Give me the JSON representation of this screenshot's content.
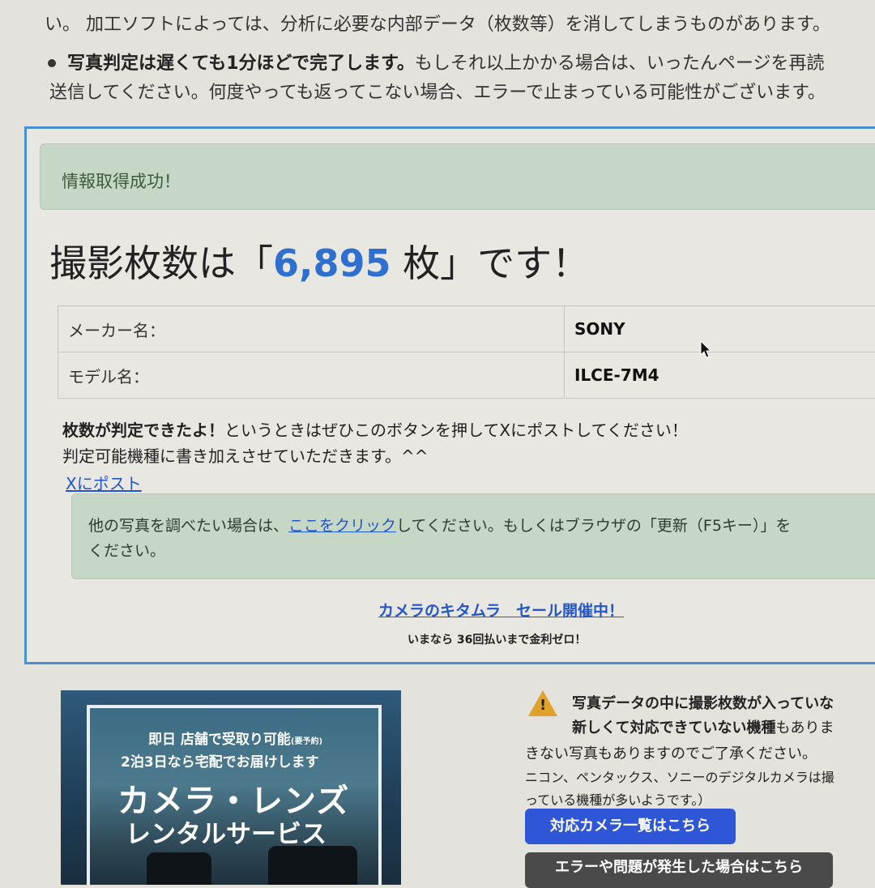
{
  "intro": {
    "line1": "い。 加工ソフトによっては、分析に必要な内部データ（枚数等）を消してしまうものがあります。",
    "bullet_bold": "写真判定は遅くても1分ほどで完了します。",
    "bullet_rest": "もしそれ以上かかる場合は、いったんページを再読",
    "bullet_line2": "送信してください。何度やっても返ってこない場合、エラーで止まっている可能性がございます。"
  },
  "result": {
    "success_message": "情報取得成功！",
    "headline_prefix": "撮影枚数は「",
    "shot_count": "6,895",
    "headline_suffix": " 枚」です！",
    "specs": [
      {
        "label": "メーカー名：",
        "value": "SONY"
      },
      {
        "label": "モデル名：",
        "value": "ILCE-7M4"
      }
    ],
    "note_bold": "枚数が判定できたよ！",
    "note_rest": "というときはぜひこのボタンを押してXにポストしてください！",
    "note_line2": "判定可能機種に書き加えさせていただきます。^^",
    "post_link": "Xにポスト",
    "other_prefix": "他の写真を調べたい場合は、",
    "other_link": "ここをクリック",
    "other_suffix": "してください。もしくはブラウザの「更新（F5キー）」を",
    "other_line2": "ください。",
    "sale_link": "カメラのキタムラ　セール開催中！",
    "sale_sub": "いまなら 36回払いまで金利ゼロ！"
  },
  "banner": {
    "line1": "即日 店舗で受取り可能",
    "line1_small": "(要予約)",
    "line2": "2泊3日なら宅配でお届けします",
    "title1": "カメラ・レンズ",
    "title2": "レンタルサービス"
  },
  "warning": {
    "icon": "warning-triangle-icon",
    "line1": "写真データの中に撮影枚数が入っていな",
    "line2_bold": "新しくて対応できていない機種",
    "line2_rest": "もありま",
    "line3": "きない写真もありますのでご了承ください。",
    "line4": "ニコン、ペンタックス、ソニーのデジタルカメラは撮",
    "line5": "っている機種が多いようです。）",
    "btn_supported": "対応カメラ一覧はこちら",
    "btn_error": "エラーや問題が発生した場合はこちら"
  }
}
